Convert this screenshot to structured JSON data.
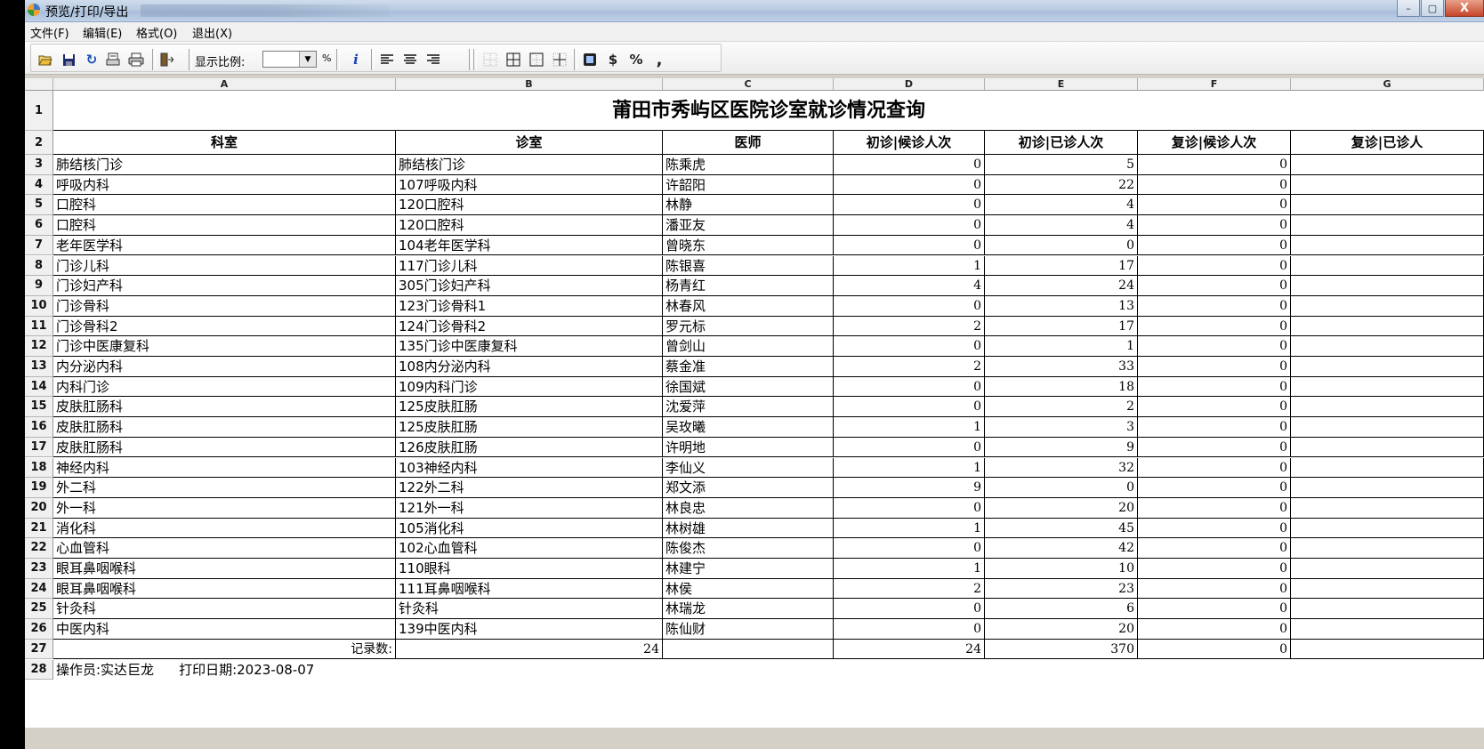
{
  "window": {
    "title": "预览/打印/导出",
    "min": "–",
    "max": "▢",
    "close": "X"
  },
  "menu": [
    {
      "label": "文件(F)"
    },
    {
      "label": "编辑(E)"
    },
    {
      "label": "格式(O)"
    },
    {
      "label": "退出(X)"
    }
  ],
  "toolbar": {
    "zoom_label": "显示比例:",
    "zoom_value": "",
    "zoom_unit": "%"
  },
  "columns": [
    "A",
    "B",
    "C",
    "D",
    "E",
    "F",
    "G"
  ],
  "report_title": "莆田市秀屿区医院诊室就诊情况查询",
  "headers": [
    "科室",
    "诊室",
    "医师",
    "初诊|候诊人次",
    "初诊|已诊人次",
    "复诊|候诊人次",
    "复诊|已诊人"
  ],
  "rows": [
    {
      "dept": "肺结核门诊",
      "room": "肺结核门诊",
      "doctor": "陈乘虎",
      "d": "0",
      "e": "5",
      "f": "0"
    },
    {
      "dept": "呼吸内科",
      "room": "107呼吸内科",
      "doctor": "许韶阳",
      "d": "0",
      "e": "22",
      "f": "0"
    },
    {
      "dept": "口腔科",
      "room": "120口腔科",
      "doctor": "林静",
      "d": "0",
      "e": "4",
      "f": "0"
    },
    {
      "dept": "口腔科",
      "room": "120口腔科",
      "doctor": "潘亚友",
      "d": "0",
      "e": "4",
      "f": "0"
    },
    {
      "dept": "老年医学科",
      "room": "104老年医学科",
      "doctor": "曾晓东",
      "d": "0",
      "e": "0",
      "f": "0"
    },
    {
      "dept": "门诊儿科",
      "room": "117门诊儿科",
      "doctor": "陈银喜",
      "d": "1",
      "e": "17",
      "f": "0"
    },
    {
      "dept": "门诊妇产科",
      "room": "305门诊妇产科",
      "doctor": "杨青红",
      "d": "4",
      "e": "24",
      "f": "0"
    },
    {
      "dept": "门诊骨科",
      "room": "123门诊骨科1",
      "doctor": "林春风",
      "d": "0",
      "e": "13",
      "f": "0"
    },
    {
      "dept": "门诊骨科2",
      "room": "124门诊骨科2",
      "doctor": "罗元标",
      "d": "2",
      "e": "17",
      "f": "0"
    },
    {
      "dept": "门诊中医康复科",
      "room": "135门诊中医康复科",
      "doctor": "曾剑山",
      "d": "0",
      "e": "1",
      "f": "0"
    },
    {
      "dept": "内分泌内科",
      "room": "108内分泌内科",
      "doctor": "蔡金准",
      "d": "2",
      "e": "33",
      "f": "0"
    },
    {
      "dept": "内科门诊",
      "room": "109内科门诊",
      "doctor": "徐国斌",
      "d": "0",
      "e": "18",
      "f": "0"
    },
    {
      "dept": "皮肤肛肠科",
      "room": "125皮肤肛肠",
      "doctor": "沈爱萍",
      "d": "0",
      "e": "2",
      "f": "0"
    },
    {
      "dept": "皮肤肛肠科",
      "room": "125皮肤肛肠",
      "doctor": "吴玫曦",
      "d": "1",
      "e": "3",
      "f": "0"
    },
    {
      "dept": "皮肤肛肠科",
      "room": "126皮肤肛肠",
      "doctor": "许明地",
      "d": "0",
      "e": "9",
      "f": "0"
    },
    {
      "dept": "神经内科",
      "room": "103神经内科",
      "doctor": "李仙义",
      "d": "1",
      "e": "32",
      "f": "0"
    },
    {
      "dept": "外二科",
      "room": "122外二科",
      "doctor": "郑文添",
      "d": "9",
      "e": "0",
      "f": "0"
    },
    {
      "dept": "外一科",
      "room": "121外一科",
      "doctor": "林良忠",
      "d": "0",
      "e": "20",
      "f": "0"
    },
    {
      "dept": "消化科",
      "room": "105消化科",
      "doctor": "林树雄",
      "d": "1",
      "e": "45",
      "f": "0"
    },
    {
      "dept": "心血管科",
      "room": "102心血管科",
      "doctor": "陈俊杰",
      "d": "0",
      "e": "42",
      "f": "0"
    },
    {
      "dept": "眼耳鼻咽喉科",
      "room": "110眼科",
      "doctor": "林建宁",
      "d": "1",
      "e": "10",
      "f": "0"
    },
    {
      "dept": "眼耳鼻咽喉科",
      "room": "111耳鼻咽喉科",
      "doctor": "林侯",
      "d": "2",
      "e": "23",
      "f": "0"
    },
    {
      "dept": "针灸科",
      "room": "针灸科",
      "doctor": "林瑞龙",
      "d": "0",
      "e": "6",
      "f": "0"
    },
    {
      "dept": "中医内科",
      "room": "139中医内科",
      "doctor": "陈仙财",
      "d": "0",
      "e": "20",
      "f": "0"
    }
  ],
  "totals": {
    "label": "记录数:",
    "count": "24",
    "d": "24",
    "e": "370",
    "f": "0"
  },
  "footer": {
    "operator": "操作员:实达巨龙",
    "print_date": "打印日期:2023-08-07"
  }
}
